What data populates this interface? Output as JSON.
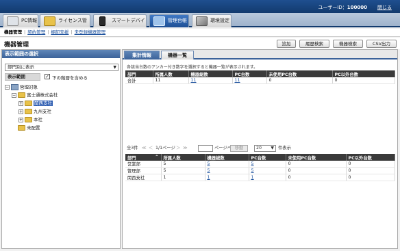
{
  "header": {
    "user_label": "ユーザーID：",
    "user_id": "100000",
    "logout": "閉じる"
  },
  "tabs": [
    {
      "label": "PC情報"
    },
    {
      "label": "ライセンス管理"
    },
    {
      "label": "スマートデバイス"
    },
    {
      "label": "管理台帳"
    },
    {
      "label": "環境設定"
    }
  ],
  "subnav": {
    "items": [
      "機器管理",
      "契約管理",
      "棚卸支援",
      "未登録機器管理"
    ]
  },
  "title": "機器管理",
  "toolbar": {
    "add": "追加",
    "history": "履歴検索",
    "search": "機器検索",
    "csv": "CSV出力"
  },
  "left": {
    "header": "表示範囲の選択",
    "select_value": "部門別に表示",
    "scope_label": "表示範囲",
    "checkbox_label": "下の階層を含める",
    "tree": [
      "管理対象",
      "富士通株式会社",
      "関西支社",
      "九州支社",
      "本社",
      "未配置"
    ]
  },
  "right": {
    "tab_summary": "集計情報",
    "tab_list": "機器一覧",
    "note": "各該当台数のアンカー付き数字を選択すると機器一覧が表示されます。",
    "summary_table": {
      "headers": [
        "部門",
        "所属人数",
        "機器総数",
        "PC台数",
        "未使用PC台数",
        "PC以外台数"
      ],
      "rows": [
        [
          "合計",
          "11",
          "11",
          "11",
          "0",
          "0"
        ]
      ]
    },
    "pager": {
      "count": "全3件",
      "nav_first": "≪",
      "nav_prev": "＜",
      "page": "1/1ページ",
      "nav_next": "＞",
      "nav_last": "≫",
      "goto_suffix": "ページへ",
      "move": "移動",
      "size": "20",
      "size_suffix": "件表示"
    },
    "list_table": {
      "headers": [
        "部門",
        "所属人数",
        "機器総数",
        "PC台数",
        "未使用PC台数",
        "PC以外台数"
      ],
      "rows": [
        [
          "営業部",
          "5",
          "5",
          "5",
          "0",
          "0"
        ],
        [
          "管理部",
          "5",
          "5",
          "5",
          "0",
          "0"
        ],
        [
          "関西支社",
          "1",
          "1",
          "1",
          "0",
          "0"
        ]
      ]
    }
  }
}
